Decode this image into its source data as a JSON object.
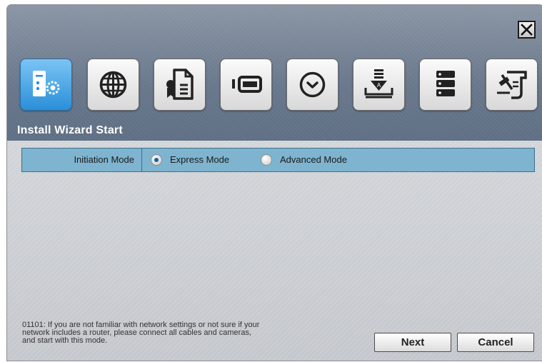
{
  "window": {
    "title": "Install Wizard Start"
  },
  "steps": [
    {
      "icon": "dvr-settings-icon",
      "active": true
    },
    {
      "icon": "network-globe-icon",
      "active": false
    },
    {
      "icon": "license-certificate-icon",
      "active": false
    },
    {
      "icon": "camera-icon",
      "active": false
    },
    {
      "icon": "clock-icon",
      "active": false
    },
    {
      "icon": "storage-install-icon",
      "active": false
    },
    {
      "icon": "server-rack-icon",
      "active": false
    },
    {
      "icon": "tools-icon",
      "active": false
    }
  ],
  "mode": {
    "label": "Initiation Mode",
    "options": [
      {
        "label": "Express Mode",
        "selected": true
      },
      {
        "label": "Advanced Mode",
        "selected": false
      }
    ]
  },
  "help": {
    "line1": "01101: If you are not familiar with network settings or not sure if your",
    "line2": "network includes a router, please connect all cables and cameras,",
    "line3": "and start with this mode."
  },
  "buttons": {
    "next": "Next",
    "cancel": "Cancel"
  },
  "colors": {
    "header": "#6e7c8f",
    "active_step": "#2a8fd8",
    "mode_row": "#7eb4cf"
  }
}
